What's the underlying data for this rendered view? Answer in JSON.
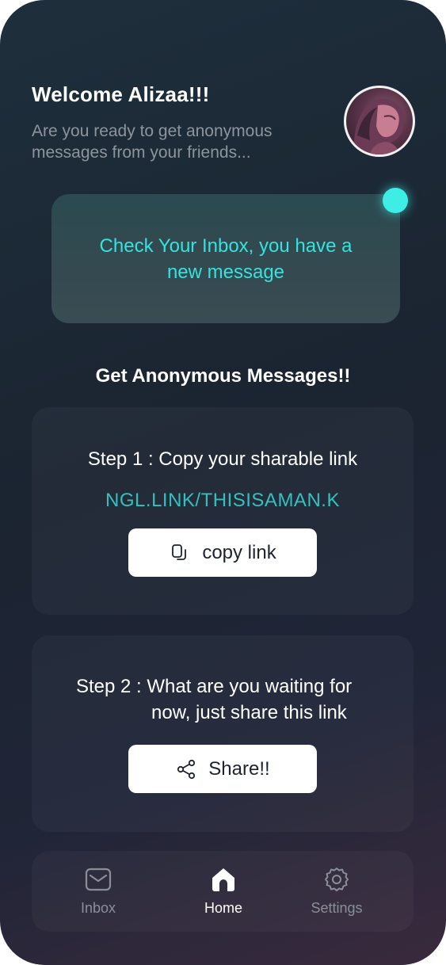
{
  "header": {
    "greeting": "Welcome Alizaa!!!",
    "subtitle": "Are you ready to get anonymous messages from your friends..."
  },
  "inbox_card": {
    "text": "Check Your Inbox, you have a new message",
    "has_notification": true
  },
  "section_title": "Get Anonymous Messages!!",
  "step1": {
    "text": "Step 1 : Copy your sharable link",
    "link": "NGL.LINK/THISISAMAN.K",
    "button_label": "copy link",
    "button_icon": "copy-icon"
  },
  "step2": {
    "text_line1": "Step 2 : What are you waiting for",
    "text_line2": "now, just share this link",
    "button_label": "Share!!",
    "button_icon": "share-icon"
  },
  "nav": {
    "items": [
      {
        "label": "Inbox",
        "icon": "mail-icon",
        "active": false
      },
      {
        "label": "Home",
        "icon": "home-icon",
        "active": true
      },
      {
        "label": "Settings",
        "icon": "gear-icon",
        "active": false
      }
    ]
  },
  "colors": {
    "accent": "#35e2dd",
    "link": "#33c1bd",
    "notification_dot": "#3eeee6",
    "muted_text": "#8e949c",
    "background": "#1b2431"
  }
}
